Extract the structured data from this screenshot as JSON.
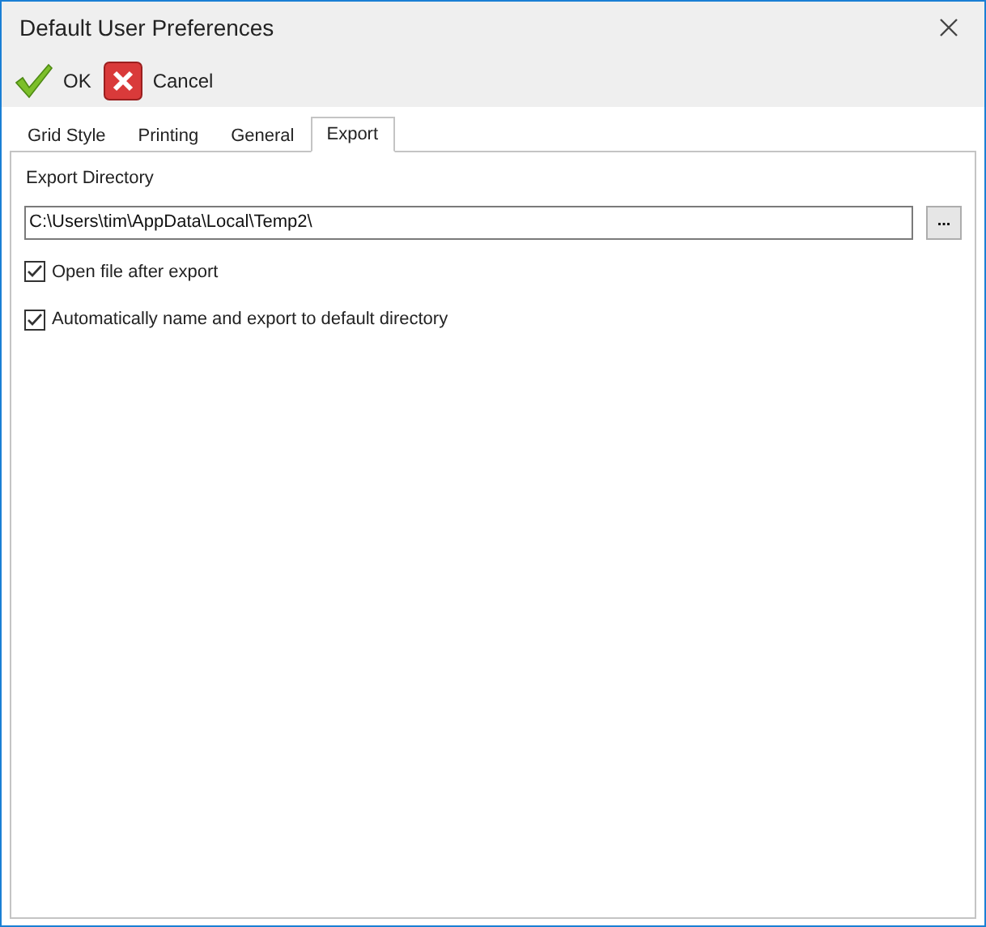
{
  "window": {
    "title": "Default User Preferences"
  },
  "toolbar": [
    {
      "kind": "ok",
      "label": "OK"
    },
    {
      "kind": "cancel",
      "label": "Cancel"
    }
  ],
  "tabs": [
    {
      "label": "Grid Style",
      "selected": false
    },
    {
      "label": "Printing",
      "selected": false
    },
    {
      "label": "General",
      "selected": false
    },
    {
      "label": "Export",
      "selected": true
    }
  ],
  "export_directory": {
    "label": "Export Directory",
    "value": "C:\\Users\\tim\\AppData\\Local\\Temp2\\",
    "browse_button": "..."
  },
  "options": [
    {
      "label": "Open file after export",
      "checked": true
    },
    {
      "label": "Automatically name and export to default directory",
      "checked": true
    }
  ]
}
